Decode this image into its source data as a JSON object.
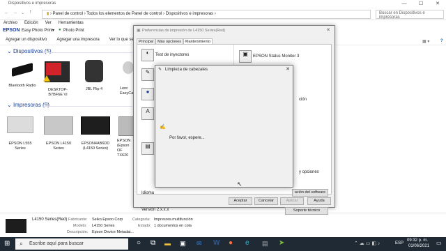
{
  "window": {
    "title": "Dispositivos e impresoras",
    "controls": [
      "—",
      "☐",
      "✕"
    ]
  },
  "address": {
    "crumbs": [
      "Panel de control",
      "Todos los elementos de Panel de control",
      "Dispositivos e impresoras"
    ],
    "search_placeholder": "Buscar en Dispositivos e impresoras"
  },
  "menubar": [
    "Archivo",
    "Edición",
    "Ver",
    "Herramientas"
  ],
  "epson_toolbar": {
    "brand": "EPSON",
    "easy_photo_print": "Easy Photo Print",
    "photo_print": "Photo Print"
  },
  "commandbar": [
    "Agregar un dispositivo",
    "Agregar una impresora",
    "Ver lo que se imprime"
  ],
  "sections": {
    "devices": "Dispositivos (5)",
    "printers": "Impresoras (9)"
  },
  "devices": [
    {
      "name": "Bluetooth Radio"
    },
    {
      "name": "DESKTOP-B7BF6E VI"
    },
    {
      "name": "JBL Flip 4"
    },
    {
      "name": "Lenc EasyCa"
    }
  ],
  "printers": [
    {
      "name": "EPSON L555 Series"
    },
    {
      "name": "EPSON L4150 Series"
    },
    {
      "name": "EPSON4AB6DD (L4150 Series)"
    },
    {
      "name": "EPSON (Epson OF TX620"
    }
  ],
  "status": {
    "name": "L4150 Series(Red)",
    "fabricante_label": "Fabricante:",
    "fabricante": "Seiko Epson Corp",
    "modelo_label": "Modelo:",
    "modelo": "L4150 Series",
    "descripcion_label": "Descripción:",
    "descripcion": "Epson Device Metadat...",
    "categoria_label": "Categoría:",
    "categoria": "Impresora multifunción",
    "estado_label": "Estado:",
    "estado": "1 documentos en cola"
  },
  "pref_dialog": {
    "title": "Preferencias de impresión de L4150 Series(Red)",
    "tabs": [
      "Principal",
      "Más opciones",
      "Mantenimiento"
    ],
    "test_inyectores": "Test de inyectores",
    "status_monitor": "EPSON Status Monitor 3",
    "peek_text_1": "ción",
    "peek_text_2": "y opciones",
    "update_button": "ación del software",
    "idioma_label": "Idioma",
    "version_label": "Versión",
    "version_value": "2.x.x.x",
    "soporte_button": "Soporte técnico",
    "aceptar": "Aceptar",
    "cancelar": "Cancelar",
    "aplicar": "Aplicar",
    "ayuda": "Ayuda"
  },
  "clean_dialog": {
    "title": "Limpieza de cabezales",
    "message": "Por favor, espere..."
  },
  "taskbar": {
    "search_placeholder": "Escribe aquí para buscar",
    "lang": "ESP",
    "time": "09:32 p. m.",
    "date": "01/06/2021"
  }
}
